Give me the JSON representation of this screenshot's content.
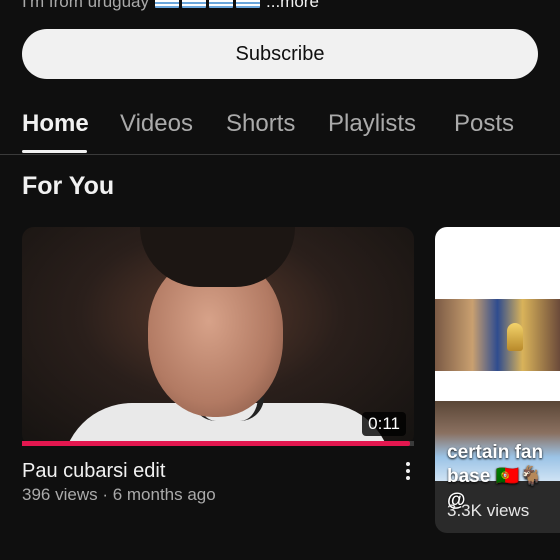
{
  "channel": {
    "about_text": "I'm from uruguay",
    "more_label": "...more"
  },
  "subscribe_label": "Subscribe",
  "tabs": [
    {
      "label": "Home",
      "active": true
    },
    {
      "label": "Videos",
      "active": false
    },
    {
      "label": "Shorts",
      "active": false
    },
    {
      "label": "Playlists",
      "active": false
    },
    {
      "label": "Posts",
      "active": false
    }
  ],
  "section": {
    "title": "For You"
  },
  "featured_video": {
    "duration": "0:11",
    "watched_fraction": 0.99,
    "title": "Pau cubarsi edit",
    "meta": "396 views · 6 months ago"
  },
  "short_card": {
    "caption": "certain fan base 🇵🇹🐐@",
    "views": "3.3K views"
  },
  "colors": {
    "background": "#0f0f0f",
    "progress": "#e3174f",
    "subscribe_bg": "#f1f1f1"
  }
}
